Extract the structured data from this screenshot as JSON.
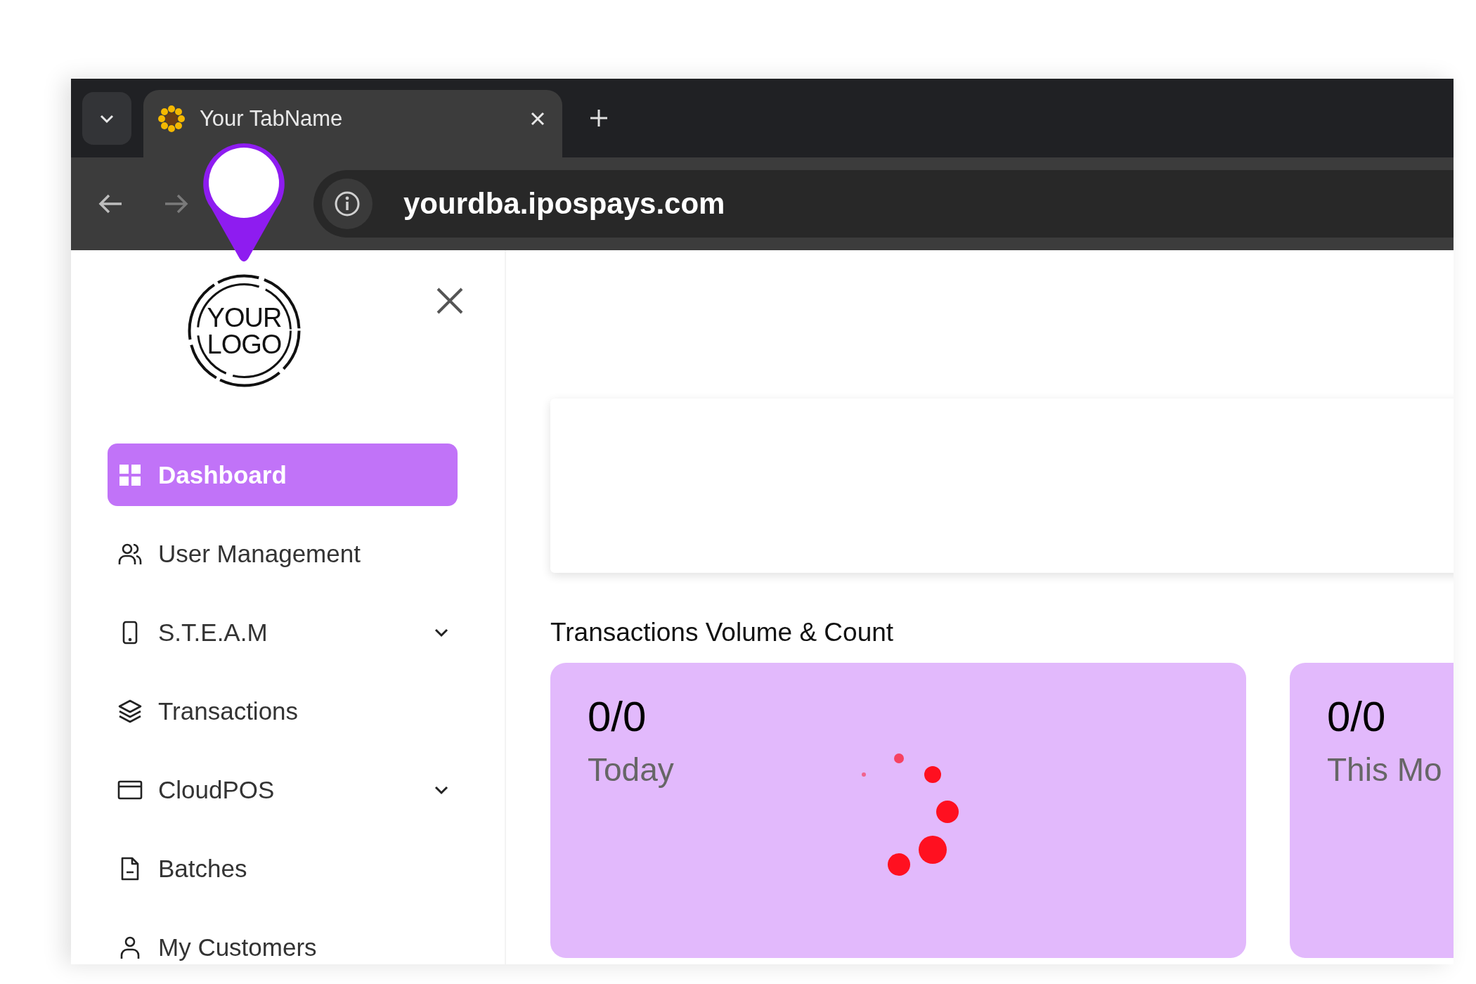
{
  "browser": {
    "tab": {
      "title": "Your TabName",
      "selected": true
    },
    "address": "yourdba.ipospays.com"
  },
  "sidebar": {
    "logo": [
      "YOUR",
      "LOGO"
    ],
    "items": [
      {
        "label": "Dashboard",
        "selected": true,
        "expandable": false
      },
      {
        "label": "User Management",
        "selected": false,
        "expandable": false
      },
      {
        "label": "S.T.E.A.M",
        "selected": false,
        "expandable": true
      },
      {
        "label": "Transactions",
        "selected": false,
        "expandable": false
      },
      {
        "label": "CloudPOS",
        "selected": false,
        "expandable": true
      },
      {
        "label": "Batches",
        "selected": false,
        "expandable": false
      },
      {
        "label": "My Customers",
        "selected": false,
        "expandable": false
      }
    ]
  },
  "main": {
    "section_title": "Transactions Volume & Count",
    "cards": [
      {
        "value": "0/0",
        "label": "Today",
        "loading": true
      },
      {
        "value": "0/0",
        "label": "This Mo"
      }
    ]
  }
}
